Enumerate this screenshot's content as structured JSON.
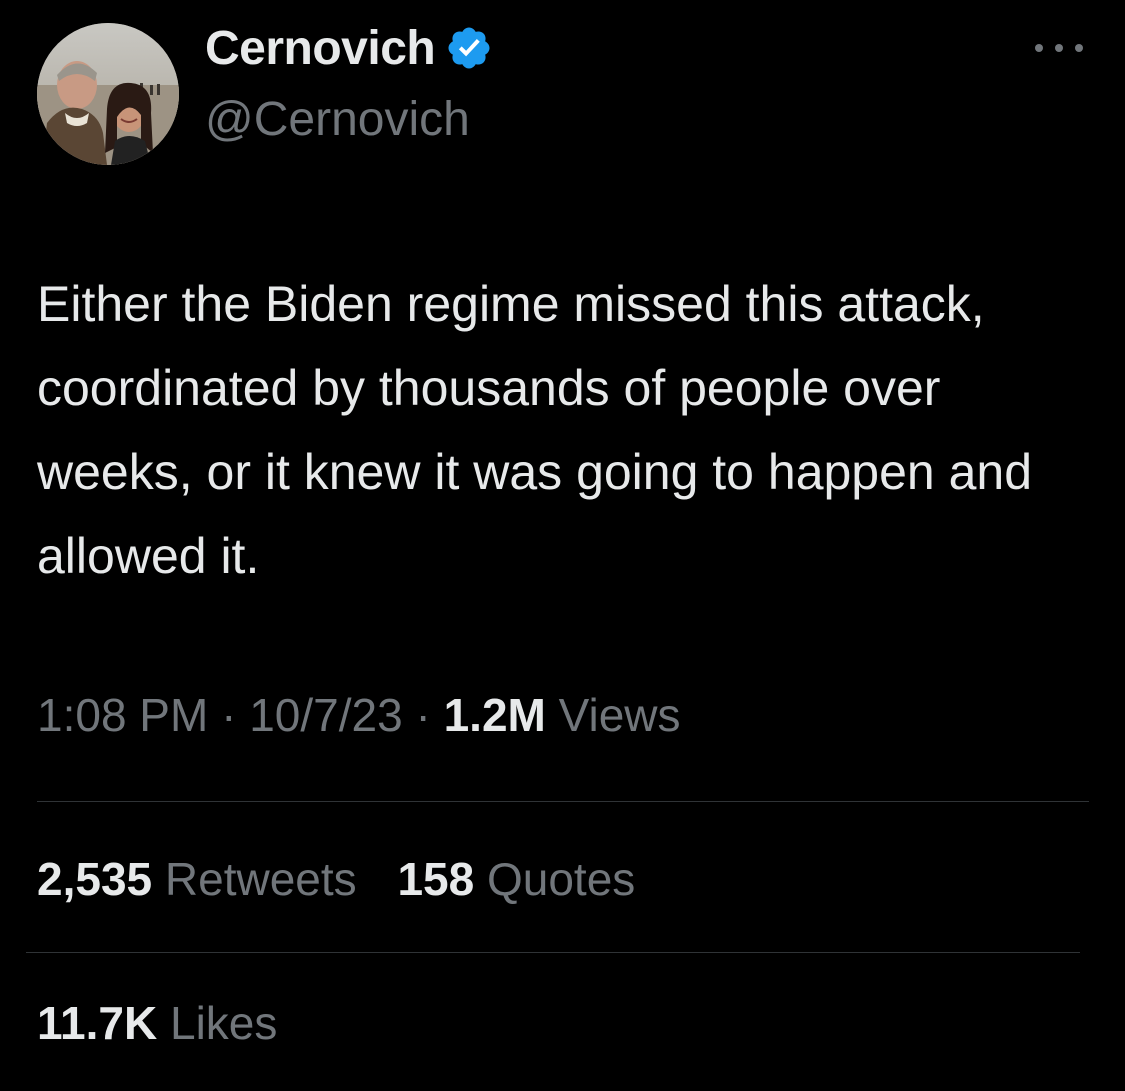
{
  "author": {
    "display_name": "Cernovich",
    "handle": "@Cernovich",
    "verified": true,
    "avatar_icon": "profile-photo"
  },
  "tweet": {
    "text": "Either the Biden regime missed this attack, coordinated by thousands of people over weeks, or it knew it was going to happen and allowed it.",
    "time": "1:08 PM",
    "separator": "·",
    "date": "10/7/23",
    "views_count": "1.2M",
    "views_label": "Views"
  },
  "stats": {
    "retweets_count": "2,535",
    "retweets_label": "Retweets",
    "quotes_count": "158",
    "quotes_label": "Quotes",
    "likes_count": "11.7K",
    "likes_label": "Likes"
  },
  "colors": {
    "background": "#000000",
    "primary_text": "#e7e9ea",
    "secondary_text": "#71767b",
    "verified_badge": "#1d9bf0",
    "divider": "#2f3336"
  }
}
